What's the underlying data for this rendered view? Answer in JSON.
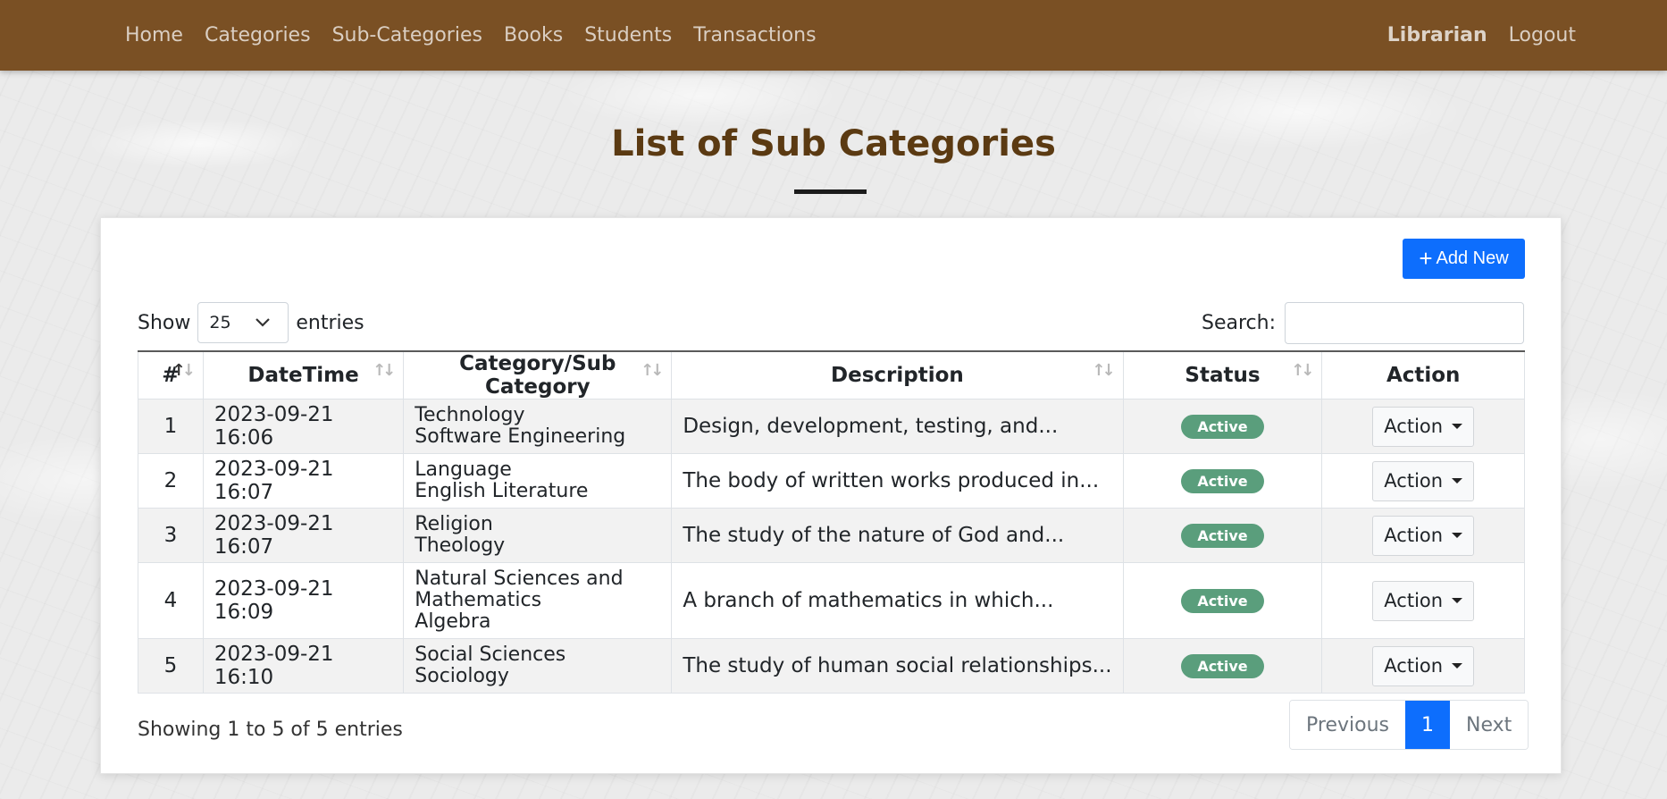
{
  "nav": {
    "items": [
      "Home",
      "Categories",
      "Sub-Categories",
      "Books",
      "Students",
      "Transactions"
    ],
    "user": "Librarian",
    "logout": "Logout"
  },
  "page": {
    "title": "List of Sub Categories",
    "add_button": "Add New"
  },
  "controls": {
    "show_label": "Show",
    "page_length": "25",
    "entries_label": "entries",
    "search_label": "Search:",
    "search_value": ""
  },
  "table": {
    "headers": [
      "#",
      "DateTime",
      "Category/Sub Category",
      "Description",
      "Status",
      "Action"
    ],
    "rows": [
      {
        "num": "1",
        "datetime": "2023-09-21 16:06",
        "category": "Technology",
        "subcategory": "Software Engineering",
        "description": "Design, development, testing, and...",
        "status": "Active",
        "action": "Action"
      },
      {
        "num": "2",
        "datetime": "2023-09-21 16:07",
        "category": "Language",
        "subcategory": "English Literature",
        "description": "The body of written works produced in...",
        "status": "Active",
        "action": "Action"
      },
      {
        "num": "3",
        "datetime": "2023-09-21 16:07",
        "category": "Religion",
        "subcategory": "Theology",
        "description": "The study of the nature of God and...",
        "status": "Active",
        "action": "Action"
      },
      {
        "num": "4",
        "datetime": "2023-09-21 16:09",
        "category": "Natural Sciences and Mathematics",
        "subcategory": "Algebra",
        "description": "A branch of mathematics in which...",
        "status": "Active",
        "action": "Action"
      },
      {
        "num": "5",
        "datetime": "2023-09-21 16:10",
        "category": "Social Sciences",
        "subcategory": "Sociology",
        "description": "The study of human social relationships...",
        "status": "Active",
        "action": "Action"
      }
    ]
  },
  "footer": {
    "info": "Showing 1 to 5 of 5 entries",
    "previous": "Previous",
    "current_page": "1",
    "next": "Next"
  },
  "colors": {
    "navbar": "#7a5024",
    "title": "#5b3a12",
    "primary": "#0d6efd",
    "active_badge": "#5a9e7c"
  }
}
